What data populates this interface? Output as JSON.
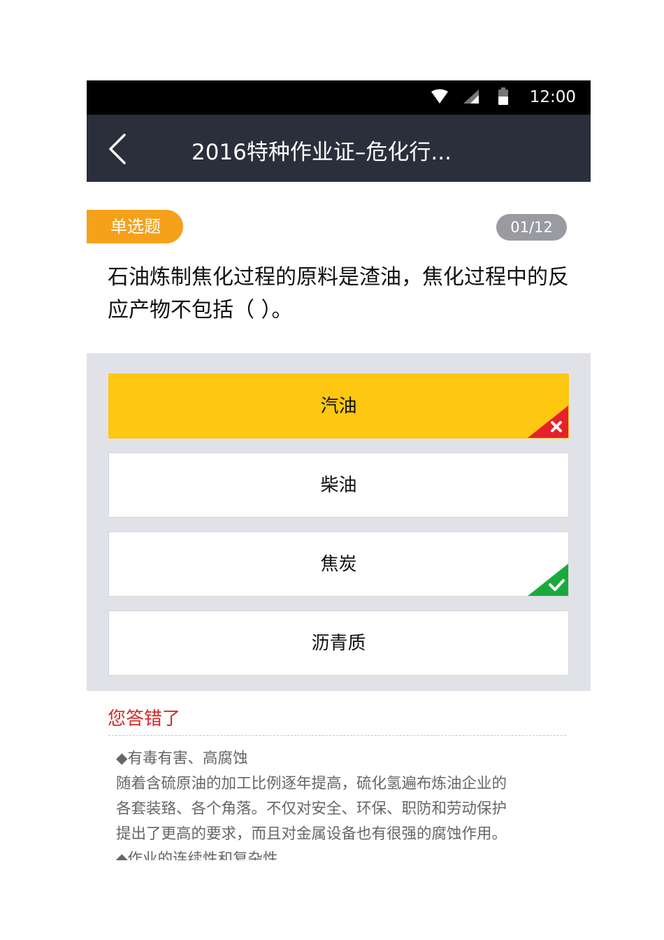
{
  "status_bar": {
    "time": "12:00",
    "icons": [
      "wifi-icon",
      "signal-icon",
      "battery-icon"
    ]
  },
  "app_bar": {
    "back_icon": "chevron-left-icon",
    "title": "2016特种作业证–危化行..."
  },
  "question": {
    "type": "单选题",
    "counter": "01/12",
    "text": "石油炼制焦化过程的原料是渣油，焦化过程中的反应产物不包括（ ）。"
  },
  "options": [
    {
      "label": "汽油",
      "state": "selected-wrong"
    },
    {
      "label": "柴油",
      "state": "none"
    },
    {
      "label": "焦炭",
      "state": "correct"
    },
    {
      "label": "沥青质",
      "state": "none"
    }
  ],
  "result": {
    "text": "您答错了"
  },
  "explanation": {
    "lines": [
      "◆有毒有害、高腐蚀",
      "随着含硫原油的加工比例逐年提高，硫化氢遍布炼油企业的",
      "各套装臵、各个角落。不仅对安全、环保、职防和劳动保护",
      "提出了更高的要求，而且对金属设备也有很强的腐蚀作用。",
      "◆作业的连续性和复杂性"
    ]
  },
  "colors": {
    "status_bar": "#000000",
    "app_bar": "#2b2f3b",
    "type_badge": "#f6a11a",
    "counter_badge": "#9a9ba1",
    "selected_option": "#fec711",
    "wrong_mark": "#e8202a",
    "correct_mark": "#1aaa3c",
    "result_text": "#d42a27"
  }
}
